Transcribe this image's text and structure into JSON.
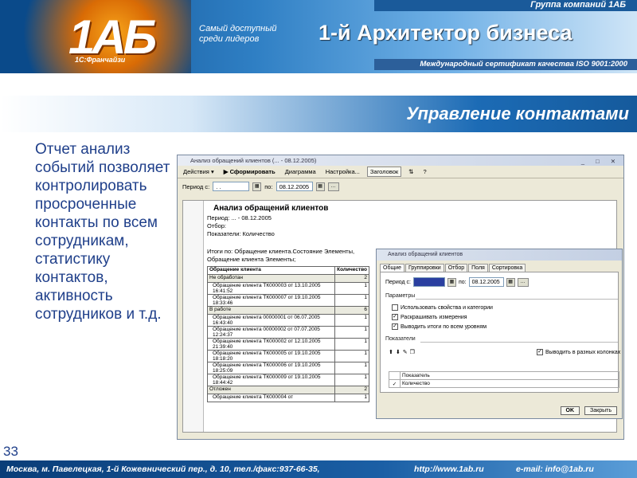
{
  "banner": {
    "group": "Группа компаний 1АБ",
    "logo_text": "1АБ",
    "franchise": "1С:Франчайзи",
    "slogan_1": "Самый доступный",
    "slogan_2": "среди лидеров",
    "brand": "1-й Архитектор бизнеса",
    "certificate": "Международный сертификат качества ISO 9001:2000"
  },
  "slide": {
    "title": "Управление контактами",
    "body": "Отчет анализ событий позволяет контролировать просроченные контакты по всем сотрудникам, статистику контактов, активность сотрудников и т.д.",
    "page_number": "33"
  },
  "footer": {
    "address": "Москва, м. Павелецкая, 1-й Кожевнический пер., д. 10, тел./факс:937-66-35,",
    "web": "http://www.1ab.ru",
    "email": "e-mail: info@1ab.ru"
  },
  "window": {
    "title": "Анализ обращений клиентов (... - 08.12.2005)",
    "menu": {
      "actions": "Действия ▾",
      "generate": "▶ Сформировать",
      "diagram": "Диаграмма",
      "settings": "Настройка...",
      "header": "Заголовок"
    },
    "period_label": "Период с:",
    "period_from": ". .",
    "period_to_label": "по:",
    "period_to": "08.12.2005",
    "report": {
      "title": "Анализ обращений клиентов",
      "period": "Период: ... - 08.12.2005",
      "filter": "Отбор:",
      "indicators": "Показатели: Количество",
      "totals_1": "Итоги по: Обращение клиента.Состояние Элементы,",
      "totals_2": "Обращение клиента Элементы;",
      "col_1": "Обращение клиента",
      "col_2": "Количество",
      "rows": [
        {
          "text": "Не обработан",
          "value": "2",
          "group": true
        },
        {
          "text": "Обращение клиента ТК000003 от 13.10.2005 16:41:52",
          "value": "1",
          "group": false
        },
        {
          "text": "Обращение клиента ТК000007 от 19.10.2005 18:33:46",
          "value": "1",
          "group": false
        },
        {
          "text": "В работе",
          "value": "6",
          "group": true
        },
        {
          "text": "Обращение клиента 00000001 от 06.07.2005 16:43:40",
          "value": "1",
          "group": false
        },
        {
          "text": "Обращение клиента 00000002 от 07.07.2005 12:24:37",
          "value": "1",
          "group": false
        },
        {
          "text": "Обращение клиента ТК000002 от 12.10.2005 21:39:40",
          "value": "1",
          "group": false
        },
        {
          "text": "Обращение клиента ТК000005 от 19.10.2005 18:18:20",
          "value": "1",
          "group": false
        },
        {
          "text": "Обращение клиента ТК000006 от 19.10.2005 18:25:09",
          "value": "1",
          "group": false
        },
        {
          "text": "Обращение клиента ТК000009 от 19.10.2005 18:44:42",
          "value": "1",
          "group": false
        },
        {
          "text": "Отложен",
          "value": "2",
          "group": true
        },
        {
          "text": "Обращение клиента ТК000004 от",
          "value": "1",
          "group": false
        }
      ]
    }
  },
  "dialog": {
    "title": "Анализ обращений клиентов",
    "tabs": [
      "Общие",
      "Группировки",
      "Отбор",
      "Поля",
      "Сортировка"
    ],
    "period_label": "Период с:",
    "period_to_label": "по:",
    "period_to": "08.12.2005",
    "params_header": "Параметры",
    "opt_1": "Использовать свойства и категории",
    "opt_2": "Раскрашивать измерения",
    "opt_3": "Выводить итоги по всем уровням",
    "indicators_header": "Показатели",
    "show_different": "Выводить в разных колонках",
    "ind_col": "Показатель",
    "ind_value": "Количество",
    "ok": "OK",
    "close": "Закрыть"
  }
}
